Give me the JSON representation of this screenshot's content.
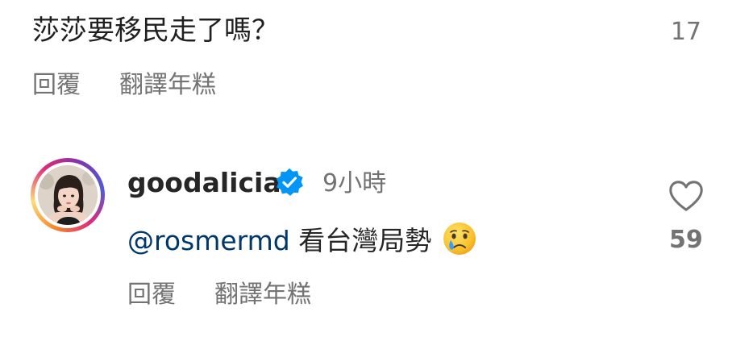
{
  "comments": [
    {
      "text": "莎莎要移民走了嗎？",
      "likes": "17",
      "reply_label": "回覆",
      "translate_label": "翻譯年糕"
    },
    {
      "username": "goodalicia",
      "verified_icon": "verified-badge-icon",
      "time": "9小時",
      "mention": "@rosmermd",
      "text": "看台灣局勢",
      "emoji": "crying-face-emoji",
      "likes": "59",
      "like_icon": "heart-outline-icon",
      "reply_label": "回覆",
      "translate_label": "翻譯年糕"
    }
  ],
  "colors": {
    "secondary_text": "#737373",
    "primary_text": "#262626",
    "mention": "#00376b",
    "verified": "#0095f6"
  }
}
